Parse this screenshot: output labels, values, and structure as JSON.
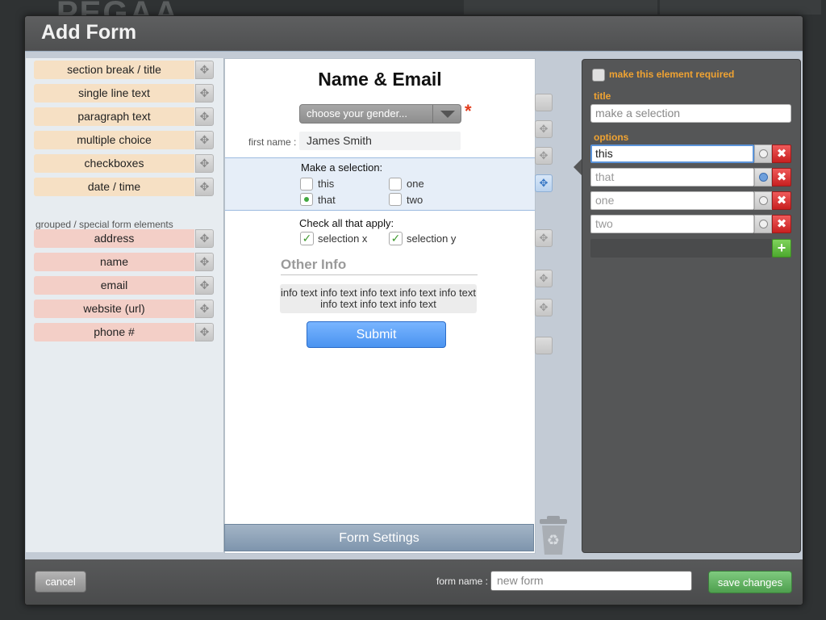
{
  "background": {
    "brand": "PEGAA"
  },
  "modal": {
    "title": "Add Form"
  },
  "palette": {
    "basic_items": [
      {
        "label": "section break / title"
      },
      {
        "label": "single line text"
      },
      {
        "label": "paragraph text"
      },
      {
        "label": "multiple choice"
      },
      {
        "label": "checkboxes"
      },
      {
        "label": "date / time"
      }
    ],
    "special_heading": "grouped / special form elements",
    "special_items": [
      {
        "label": "address"
      },
      {
        "label": "name"
      },
      {
        "label": "email"
      },
      {
        "label": "website (url)"
      },
      {
        "label": "phone #"
      }
    ],
    "handle_icon": "move-arrows-icon",
    "colors": {
      "basic": "#f6e0c4",
      "special": "#f3cfc7"
    }
  },
  "form": {
    "title": "Name & Email",
    "gender_select": "choose your gender...",
    "required_mark": "*",
    "first_name_label": "first name :",
    "first_name_value": "James Smith",
    "selection": {
      "question": "Make a selection:",
      "options": [
        {
          "label": "this",
          "selected": false
        },
        {
          "label": "one",
          "selected": false
        },
        {
          "label": "that",
          "selected": true
        },
        {
          "label": "two",
          "selected": false
        }
      ]
    },
    "checkboxes": {
      "question": "Check all that apply:",
      "options": [
        {
          "label": "selection x",
          "checked": true
        },
        {
          "label": "selection y",
          "checked": true
        }
      ]
    },
    "other_info_heading": "Other Info",
    "info_text": "info text info text info text info text info text info text info text info text",
    "submit_label": "Submit",
    "settings_label": "Form Settings"
  },
  "properties": {
    "required_label": "make this element required",
    "required_checked": false,
    "title_label": "title",
    "title_placeholder": "make a selection",
    "options_label": "options",
    "options": [
      {
        "value": "this",
        "default": false,
        "editing": true
      },
      {
        "value": "that",
        "default": true,
        "editing": false
      },
      {
        "value": "one",
        "default": false,
        "editing": false
      },
      {
        "value": "two",
        "default": false,
        "editing": false
      }
    ],
    "accent_color": "#f0a332"
  },
  "footer": {
    "cancel_label": "cancel",
    "form_name_label": "form name :",
    "form_name_placeholder": "new form",
    "save_label": "save changes"
  }
}
